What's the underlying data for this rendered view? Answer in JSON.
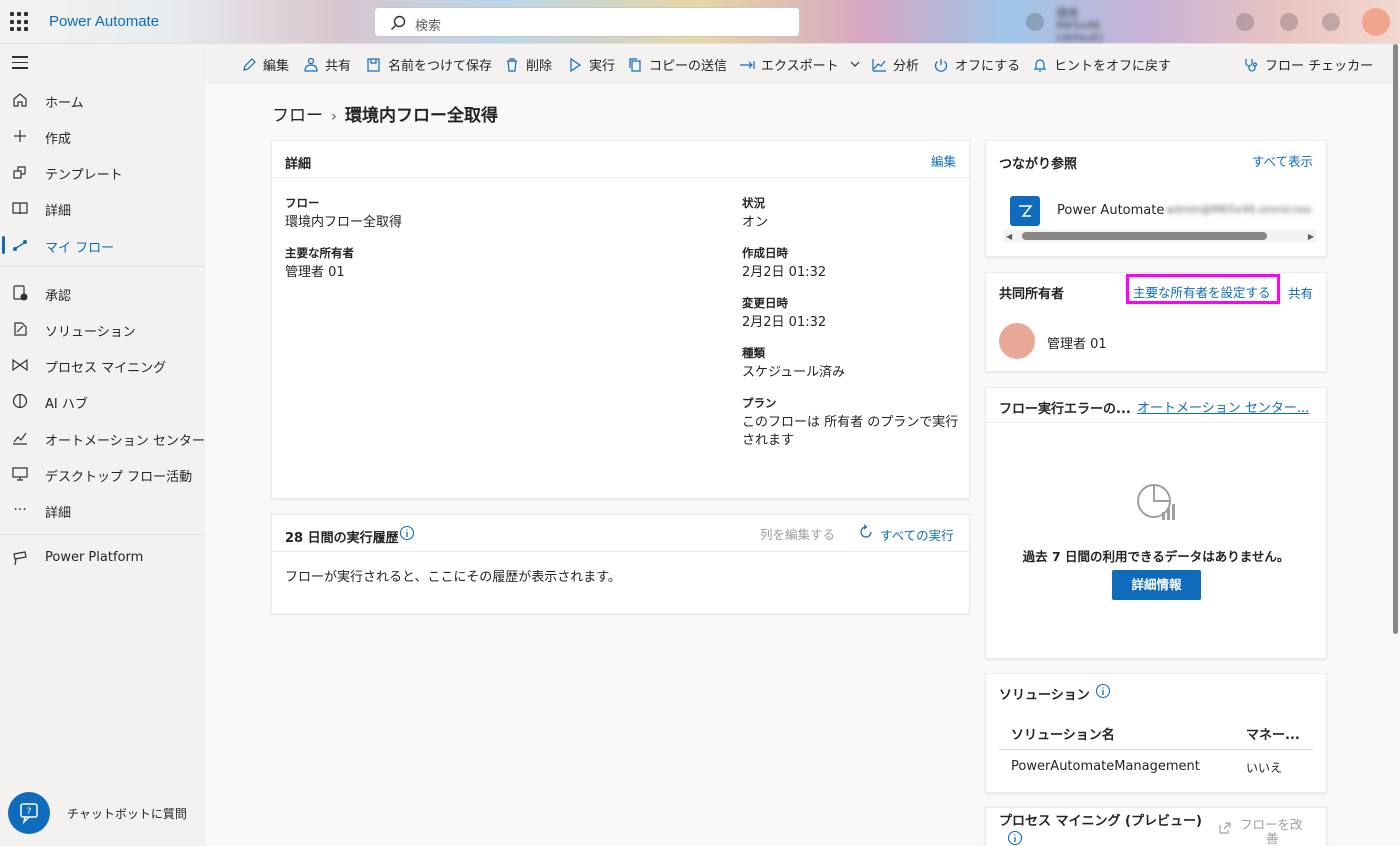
{
  "app": {
    "title": "Power Automate",
    "search_placeholder": "検索",
    "env_label": "環境",
    "env_name": "M65x46 (default)"
  },
  "sidebar": {
    "items": [
      {
        "label": "ホーム",
        "icon": "home-icon"
      },
      {
        "label": "作成",
        "icon": "plus-icon"
      },
      {
        "label": "テンプレート",
        "icon": "template-icon"
      },
      {
        "label": "詳細",
        "icon": "book-icon"
      },
      {
        "label": "マイ フロー",
        "icon": "flow-icon",
        "active": true
      },
      {
        "label": "承認",
        "icon": "approval-icon"
      },
      {
        "label": "ソリューション",
        "icon": "solution-icon"
      },
      {
        "label": "プロセス マイニング",
        "icon": "process-mining-icon"
      },
      {
        "label": "AI ハブ",
        "icon": "ai-hub-icon"
      },
      {
        "label": "オートメーション センター",
        "icon": "chart-icon"
      },
      {
        "label": "デスクトップ フロー活動",
        "icon": "desktop-icon"
      },
      {
        "label": "詳細",
        "icon": "more-icon"
      },
      {
        "label": "Power Platform",
        "icon": "power-platform-icon"
      }
    ],
    "chatbot_label": "チャットボットに質問"
  },
  "toolbar": {
    "edit": "編集",
    "share": "共有",
    "save_as": "名前をつけて保存",
    "delete": "削除",
    "run": "実行",
    "send_copy": "コピーの送信",
    "export": "エクスポート",
    "analytics": "分析",
    "turn_off": "オフにする",
    "hints": "ヒントをオフに戻す",
    "checker": "フロー チェッカー"
  },
  "breadcrumb": {
    "root": "フロー",
    "current": "環境内フロー全取得"
  },
  "details": {
    "title": "詳細",
    "edit": "編集",
    "flow_label": "フロー",
    "flow_value": "環境内フロー全取得",
    "owner_label": "主要な所有者",
    "owner_value": "管理者 01",
    "status_label": "状況",
    "status_value": "オン",
    "created_label": "作成日時",
    "created_value": "2月2日 01:32",
    "modified_label": "変更日時",
    "modified_value": "2月2日 01:32",
    "type_label": "種類",
    "type_value": "スケジュール済み",
    "plan_label": "プラン",
    "plan_value_line1": "このフローは 所有者 のプランで実行",
    "plan_value_line2": "されます"
  },
  "run_history": {
    "title": "28 日間の実行履歴",
    "edit_columns": "列を編集する",
    "all_runs": "すべての実行",
    "empty": "フローが実行されると、ここにその履歴が表示されます。"
  },
  "connections": {
    "title": "つながり参照",
    "show_all": "すべて表示",
    "item_name": "Power Automate",
    "item_account": "admin@M65x46.onmicrosoft.com"
  },
  "co_owners": {
    "title": "共同所有者",
    "set_primary": "主要な所有者を設定する",
    "share": "共有",
    "owner_name": "管理者 01"
  },
  "run_errors": {
    "title": "フロー実行エラーの...",
    "link": "オートメーション センター...",
    "empty": "過去 7 日間の利用できるデータはありません。",
    "button": "詳細情報"
  },
  "solutions": {
    "title": "ソリューション",
    "col_name": "ソリューション名",
    "col_managed": "マネー...",
    "rows": [
      {
        "name": "PowerAutomateManagement",
        "managed": "いいえ"
      }
    ]
  },
  "process_mining": {
    "title": "プロセス マイニング (プレビュー)",
    "improve_line1": "フローを改",
    "improve_line2": "善"
  },
  "colors": {
    "accent": "#0f6cbd",
    "highlight": "#ff00ff",
    "avatar": "#e8a898"
  }
}
